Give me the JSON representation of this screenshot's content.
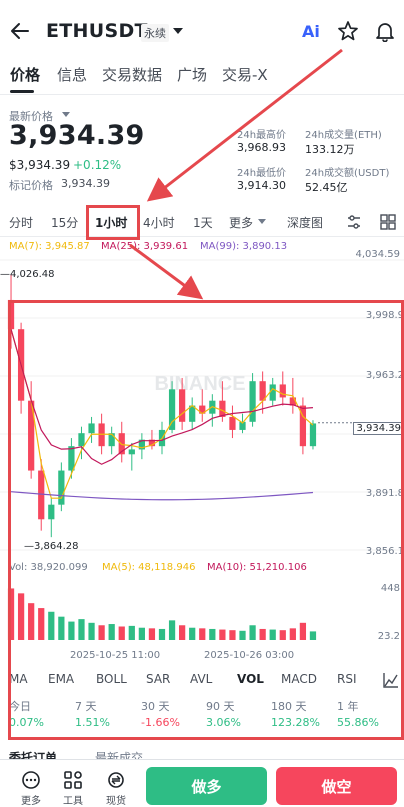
{
  "header": {
    "symbol": "ETHUSDT",
    "contract_type": "永续",
    "ai_label": "Ai"
  },
  "tabs": [
    "价格",
    "信息",
    "交易数据",
    "广场",
    "交易-X"
  ],
  "price_block": {
    "last_price_label": "最新价格",
    "last_price": "3,934.39",
    "usd_price": "$3,934.39",
    "change": "+0.12%",
    "mark_label": "标记价格",
    "mark_price": "3,934.39"
  },
  "stats": {
    "high_label": "24h最高价",
    "high": "3,968.93",
    "vol_eth_label": "24h成交量(ETH)",
    "vol_eth": "133.12万",
    "low_label": "24h最低价",
    "low": "3,914.30",
    "vol_usdt_label": "24h成交额(USDT)",
    "vol_usdt": "52.45亿"
  },
  "intervals": [
    "分时",
    "15分",
    "1小时",
    "4小时",
    "1天",
    "更多",
    "深度图"
  ],
  "ma": {
    "ma7": "MA(7): 3,945.87",
    "ma25": "MA(25): 3,939.61",
    "ma99": "MA(99): 3,890.13"
  },
  "price_axis": [
    "4,034.59",
    "3,998.9",
    "3,963.2",
    "3,934.39",
    "3,891.8",
    "3,856.1"
  ],
  "high_marker": "4,026.48",
  "low_marker": "3,864.28",
  "watermark": "BINANCE",
  "volume": {
    "vol": "Vol: 38,920.099",
    "ma5": "MA(5): 48,118.946",
    "ma10": "MA(10): 51,210.106",
    "axis": [
      "448",
      "23.2"
    ]
  },
  "time_axis": [
    "2025-10-25 11:00",
    "2025-10-26 03:00"
  ],
  "indicators": [
    "MA",
    "EMA",
    "BOLL",
    "SAR",
    "AVL",
    "VOL",
    "MACD",
    "RSI"
  ],
  "performance": {
    "labels": [
      "今日",
      "7 天",
      "30 天",
      "90 天",
      "180 天",
      "1 年"
    ],
    "values": [
      "0.07%",
      "1.51%",
      "-1.66%",
      "3.06%",
      "123.28%",
      "55.86%"
    ]
  },
  "bottom_tabs": [
    "委托订单",
    "最新成交"
  ],
  "bottom_nav": [
    "更多",
    "工具",
    "现货"
  ],
  "actions": {
    "buy": "做多",
    "sell": "做空"
  },
  "colors": {
    "up": "#2ebd85",
    "down": "#f6465d",
    "ma7": "#f0b90b",
    "ma25": "#c2185b",
    "ma99": "#7e57c2",
    "annotation": "#e5484d"
  },
  "chart_data": {
    "type": "candlestick",
    "interval": "1小时",
    "ylim": [
      3856.1,
      4034.59
    ],
    "candles_ohlc": [
      [
        4010,
        4026,
        3980,
        3992
      ],
      [
        3992,
        3996,
        3940,
        3948
      ],
      [
        3948,
        3960,
        3900,
        3905
      ],
      [
        3905,
        3912,
        3868,
        3875
      ],
      [
        3875,
        3888,
        3864,
        3884
      ],
      [
        3884,
        3910,
        3880,
        3905
      ],
      [
        3905,
        3925,
        3900,
        3920
      ],
      [
        3920,
        3932,
        3912,
        3928
      ],
      [
        3928,
        3938,
        3922,
        3934
      ],
      [
        3934,
        3940,
        3915,
        3920
      ],
      [
        3920,
        3932,
        3915,
        3928
      ],
      [
        3928,
        3935,
        3910,
        3915
      ],
      [
        3915,
        3922,
        3905,
        3918
      ],
      [
        3918,
        3928,
        3912,
        3924
      ],
      [
        3924,
        3930,
        3918,
        3920
      ],
      [
        3920,
        3935,
        3915,
        3930
      ],
      [
        3930,
        3960,
        3928,
        3955
      ],
      [
        3955,
        3962,
        3930,
        3935
      ],
      [
        3935,
        3950,
        3930,
        3945
      ],
      [
        3945,
        3955,
        3935,
        3940
      ],
      [
        3940,
        3952,
        3932,
        3948
      ],
      [
        3948,
        3960,
        3935,
        3938
      ],
      [
        3938,
        3945,
        3925,
        3930
      ],
      [
        3930,
        3940,
        3928,
        3935
      ],
      [
        3935,
        3965,
        3932,
        3960
      ],
      [
        3960,
        3966,
        3940,
        3948
      ],
      [
        3948,
        3962,
        3945,
        3958
      ],
      [
        3958,
        3966,
        3945,
        3950
      ],
      [
        3950,
        3962,
        3940,
        3945
      ],
      [
        3945,
        3950,
        3915,
        3920
      ],
      [
        3920,
        3936,
        3918,
        3934
      ]
    ],
    "volumes": [
      420,
      380,
      300,
      260,
      230,
      190,
      150,
      170,
      140,
      120,
      130,
      110,
      115,
      100,
      95,
      90,
      160,
      120,
      100,
      95,
      90,
      85,
      80,
      75,
      120,
      90,
      85,
      80,
      95,
      140,
      70
    ]
  }
}
